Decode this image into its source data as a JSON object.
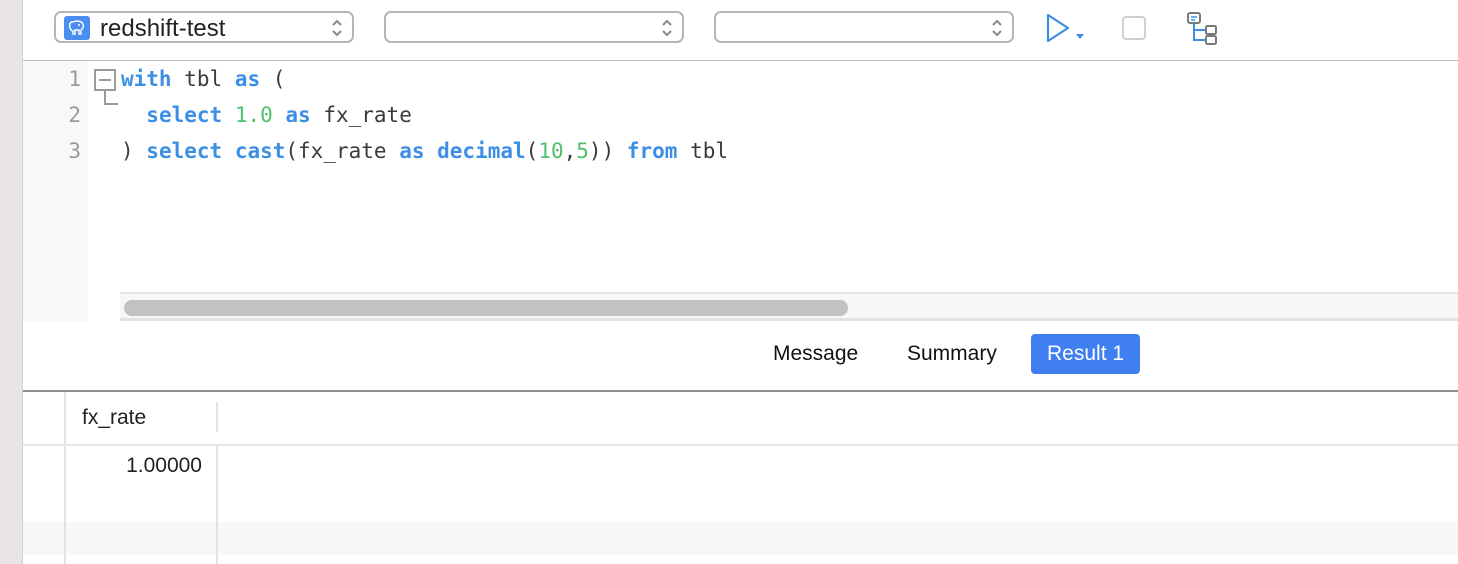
{
  "toolbar": {
    "connection": {
      "label": "redshift-test",
      "icon": "postgres-elephant-icon"
    },
    "database": {
      "label": ""
    },
    "schema": {
      "label": ""
    },
    "run_icon": "play-icon",
    "stop_icon": "stop-icon",
    "explain_icon": "explain-tree-icon"
  },
  "editor": {
    "line_numbers": [
      "1",
      "2",
      "3"
    ],
    "lines": [
      [
        {
          "t": "with",
          "c": "kw"
        },
        {
          "t": " tbl ",
          "c": ""
        },
        {
          "t": "as",
          "c": "kw"
        },
        {
          "t": " (",
          "c": ""
        }
      ],
      [
        {
          "t": "  ",
          "c": ""
        },
        {
          "t": "select",
          "c": "kw"
        },
        {
          "t": " ",
          "c": ""
        },
        {
          "t": "1.0",
          "c": "num"
        },
        {
          "t": " ",
          "c": ""
        },
        {
          "t": "as",
          "c": "kw"
        },
        {
          "t": " fx_rate",
          "c": ""
        }
      ],
      [
        {
          "t": ") ",
          "c": ""
        },
        {
          "t": "select",
          "c": "kw"
        },
        {
          "t": " ",
          "c": ""
        },
        {
          "t": "cast",
          "c": "kw"
        },
        {
          "t": "(fx_rate ",
          "c": ""
        },
        {
          "t": "as",
          "c": "kw"
        },
        {
          "t": " ",
          "c": ""
        },
        {
          "t": "decimal",
          "c": "kw"
        },
        {
          "t": "(",
          "c": ""
        },
        {
          "t": "10",
          "c": "num"
        },
        {
          "t": ",",
          "c": ""
        },
        {
          "t": "5",
          "c": "num"
        },
        {
          "t": ")) ",
          "c": ""
        },
        {
          "t": "from",
          "c": "kw"
        },
        {
          "t": " tbl",
          "c": ""
        }
      ]
    ],
    "hscroll_fraction_visible": 0.54
  },
  "tabs": [
    {
      "label": "Message",
      "active": false
    },
    {
      "label": "Summary",
      "active": false
    },
    {
      "label": "Result 1",
      "active": true
    }
  ],
  "result": {
    "columns": [
      "fx_rate"
    ],
    "rows": [
      [
        "1.00000"
      ]
    ]
  },
  "colors": {
    "keyword": "#3d8fe6",
    "number": "#4fc16a",
    "active_tab": "#3f7ff2"
  }
}
